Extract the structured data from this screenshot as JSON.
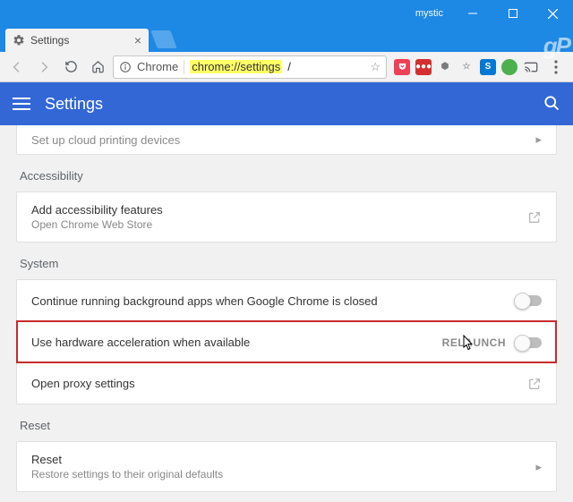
{
  "window": {
    "user_label": "mystic"
  },
  "tab": {
    "title": "Settings"
  },
  "omnibox": {
    "origin_chip": "Chrome",
    "url_highlighted": "chrome://settings",
    "url_rest": "/"
  },
  "header": {
    "title": "Settings"
  },
  "peek_row": {
    "label": "Set up cloud printing devices"
  },
  "sections": {
    "accessibility": {
      "title": "Accessibility",
      "row": {
        "label": "Add accessibility features",
        "sub": "Open Chrome Web Store"
      }
    },
    "system": {
      "title": "System",
      "rows": [
        {
          "label": "Continue running background apps when Google Chrome is closed"
        },
        {
          "label": "Use hardware acceleration when available",
          "action": "RELAUNCH"
        },
        {
          "label": "Open proxy settings"
        }
      ]
    },
    "reset": {
      "title": "Reset",
      "row": {
        "label": "Reset",
        "sub": "Restore settings to their original defaults"
      }
    }
  }
}
